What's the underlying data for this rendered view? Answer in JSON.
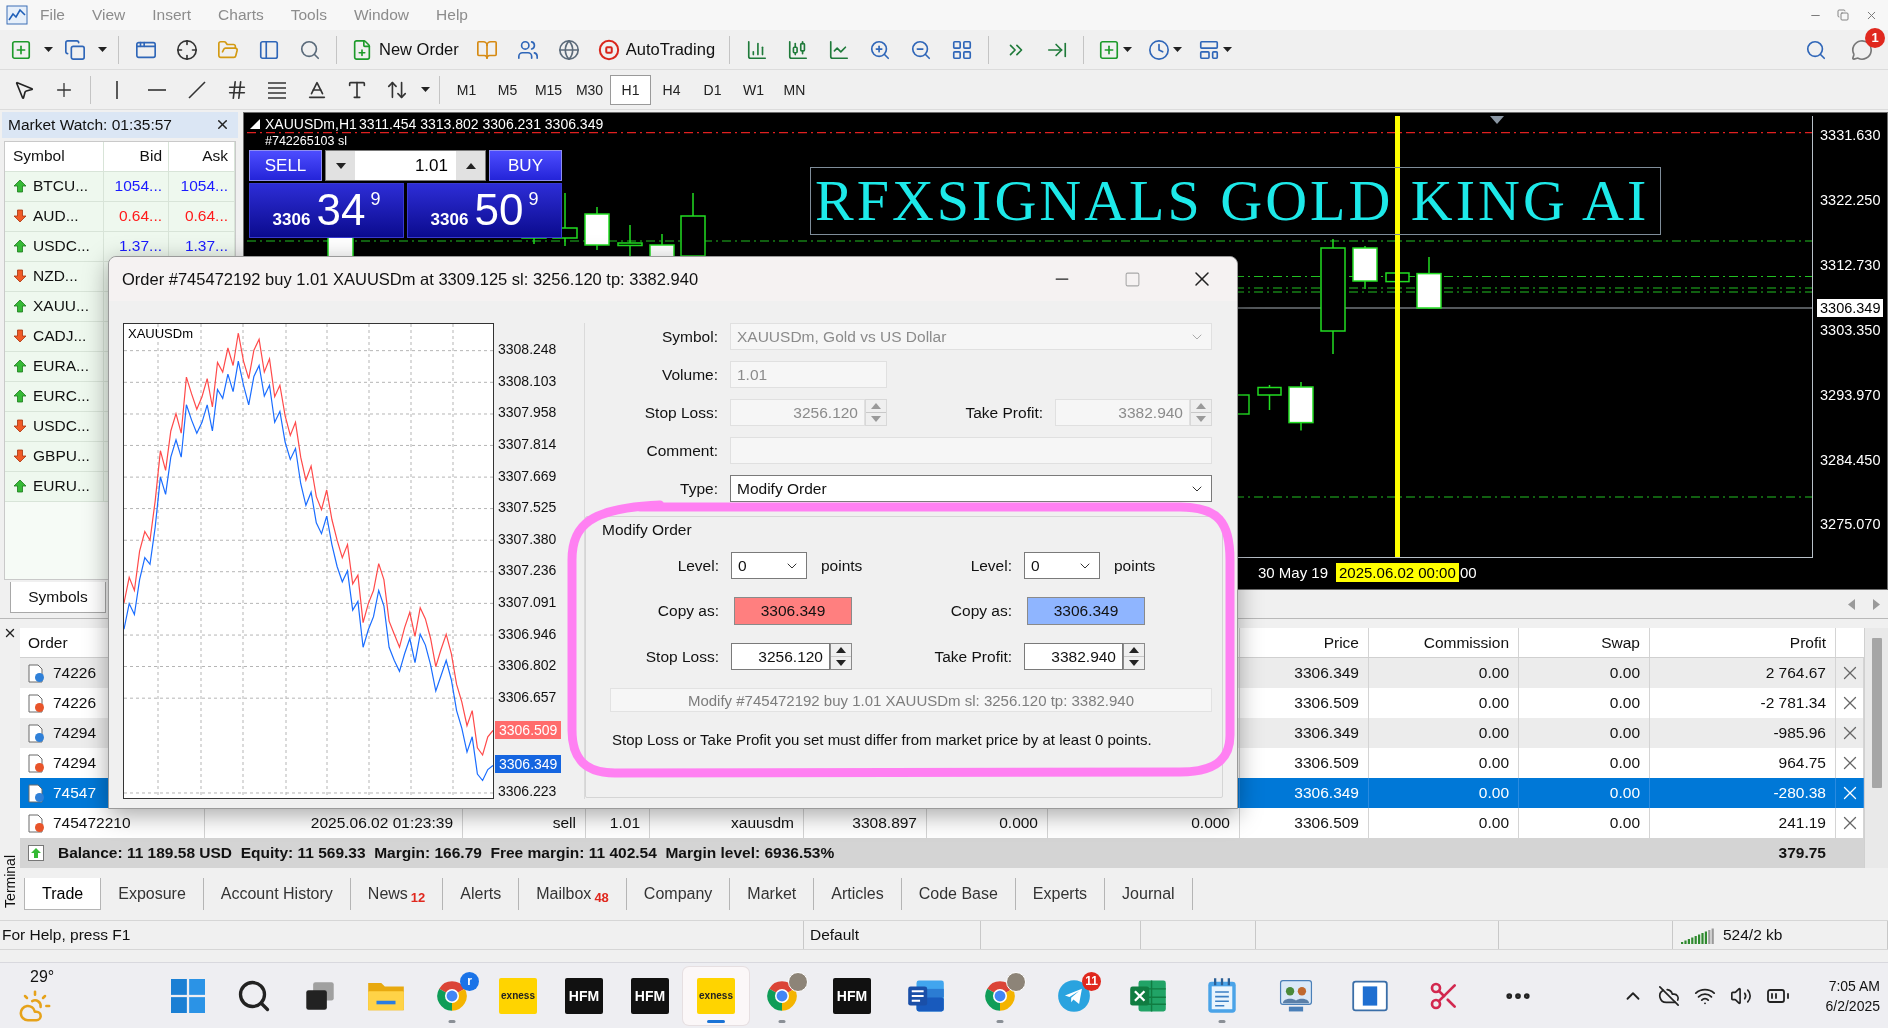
{
  "menu_bar": {
    "items": [
      "File",
      "View",
      "Insert",
      "Charts",
      "Tools",
      "Window",
      "Help"
    ]
  },
  "toolbar": {
    "new_order": "New Order",
    "auto_trading": "AutoTrading",
    "notification_badge": "1"
  },
  "timeframes": [
    {
      "label": "M1",
      "selected": false
    },
    {
      "label": "M5",
      "selected": false
    },
    {
      "label": "M15",
      "selected": false
    },
    {
      "label": "M30",
      "selected": false
    },
    {
      "label": "H1",
      "selected": true
    },
    {
      "label": "H4",
      "selected": false
    },
    {
      "label": "D1",
      "selected": false
    },
    {
      "label": "W1",
      "selected": false
    },
    {
      "label": "MN",
      "selected": false
    }
  ],
  "market_watch": {
    "title": "Market Watch: 01:35:57",
    "columns": [
      "Symbol",
      "Bid",
      "Ask"
    ],
    "rows": [
      {
        "symbol": "BTCU...",
        "bid": "1054...",
        "ask": "1054...",
        "kind": "up"
      },
      {
        "symbol": "AUD...",
        "bid": "0.64...",
        "ask": "0.64...",
        "kind": "down"
      },
      {
        "symbol": "USDC...",
        "bid": "1.37...",
        "ask": "1.37...",
        "kind": "up"
      },
      {
        "symbol": "NZD...",
        "kind": "down"
      },
      {
        "symbol": "XAUU...",
        "kind": "up"
      },
      {
        "symbol": "CADJ...",
        "kind": "down"
      },
      {
        "symbol": "EURA...",
        "kind": "up"
      },
      {
        "symbol": "EURC...",
        "kind": "up"
      },
      {
        "symbol": "USDC...",
        "kind": "down"
      },
      {
        "symbol": "GBPU...",
        "kind": "down"
      },
      {
        "symbol": "EURU...",
        "kind": "up"
      }
    ],
    "tab": "Symbols"
  },
  "chart": {
    "symbol_period": "XAUUSDm,H1",
    "ohlc": "3311.454 3313.802 3306.231 3306.349",
    "order_line_label": "#742265103 sl",
    "banner": "RFXSIGNALS GOLD KING AI",
    "price_scale": [
      "3331.630",
      "3322.250",
      "3312.730",
      "3303.350",
      "3293.970",
      "3284.450",
      "3275.070"
    ],
    "current_price": "3306.349",
    "time_scale": [
      {
        "kind": "label",
        "text": "30 May 19"
      },
      {
        "kind": "marker",
        "text": "2025.06.02 00:00"
      },
      {
        "kind": "label",
        "text": "00"
      }
    ]
  },
  "one_click": {
    "sell": "SELL",
    "buy": "BUY",
    "volume": "1.01",
    "sell_price": {
      "figure": "3306",
      "pips": "34",
      "point": "9"
    },
    "buy_price": {
      "figure": "3306",
      "pips": "50",
      "point": "9"
    }
  },
  "order_dialog": {
    "title": "Order #745472192 buy 1.01 XAUUSDm at 3309.125 sl: 3256.120 tp: 3382.940",
    "tick_chart": {
      "chart_data": {
        "type": "line",
        "title": "XAUUSDm",
        "grid": true,
        "ylim": [
          3306.2,
          3308.37
        ],
        "yticks": [
          3308.248,
          3308.103,
          3307.958,
          3307.814,
          3307.669,
          3307.525,
          {
            "value": 3307.38,
            "label": "3307.380"
          },
          3307.236,
          3307.091,
          3306.946,
          3306.802,
          3306.657,
          3306.223
        ],
        "series": [
          {
            "color": "#ff4a4a",
            "values": [
              3307.093,
              3307.21,
              3307.15,
              3307.33,
              3307.42,
              3307.38,
              3307.56,
              3307.79,
              3307.7,
              3307.88,
              3307.96,
              3307.87,
              3308.127,
              3308.05,
              3307.98,
              3308.037,
              3308.12,
              3307.99,
              3308.194,
              3308.15,
              3308.26,
              3308.18,
              3308.329,
              3308.2,
              3308.12,
              3308.25,
              3308.3,
              3308.15,
              3308.21,
              3308.037,
              3308.09,
              3307.95,
              3307.86,
              3307.92,
              3307.76,
              3307.655,
              3307.72,
              3307.58,
              3307.52,
              3307.61,
              3307.475,
              3307.38,
              3307.3,
              3307.36,
              3307.18,
              3307.22,
              3307.003,
              3307.09,
              3307.15,
              3307.273,
              3307.2,
              3307.01,
              3306.95,
              3306.891,
              3306.98,
              3307.05,
              3306.94,
              3307.071,
              3307.02,
              3306.93,
              3306.801,
              3306.88,
              3306.95,
              3306.86,
              3306.72,
              3306.64,
              3306.531,
              3306.6,
              3306.43,
              3306.397,
              3306.48,
              3306.509
            ]
          },
          {
            "color": "#1a6dff",
            "values": [
              3306.973,
              3307.09,
              3307.04,
              3307.2,
              3307.3,
              3307.27,
              3307.44,
              3307.67,
              3307.59,
              3307.76,
              3307.84,
              3307.76,
              3308,
              3307.93,
              3307.87,
              3307.92,
              3308,
              3307.88,
              3308.07,
              3308.03,
              3308.14,
              3308.06,
              3308.2,
              3308.09,
              3308,
              3308.13,
              3308.18,
              3308.04,
              3308.09,
              3307.92,
              3307.97,
              3307.83,
              3307.75,
              3307.8,
              3307.64,
              3307.54,
              3307.6,
              3307.46,
              3307.41,
              3307.49,
              3307.36,
              3307.26,
              3307.19,
              3307.24,
              3307.06,
              3307.1,
              3306.89,
              3306.97,
              3307.03,
              3307.15,
              3307.08,
              3306.89,
              3306.83,
              3306.78,
              3306.86,
              3306.93,
              3306.82,
              3306.95,
              3306.9,
              3306.81,
              3306.69,
              3306.76,
              3306.83,
              3306.74,
              3306.6,
              3306.52,
              3306.41,
              3306.48,
              3306.31,
              3306.28,
              3306.33,
              3306.349
            ]
          }
        ]
      },
      "ask": "3306.509",
      "bid": "3306.349"
    },
    "symbol": {
      "label": "Symbol:",
      "value": "XAUUSDm, Gold vs US Dollar",
      "disabled": true
    },
    "volume": {
      "label": "Volume:",
      "value": "1.01",
      "disabled": true
    },
    "stop_loss": {
      "label": "Stop Loss:",
      "value": "3256.120",
      "disabled": true
    },
    "take_profit": {
      "label": "Take Profit:",
      "value": "3382.940",
      "disabled": true
    },
    "comment": {
      "label": "Comment:",
      "disabled": true
    },
    "type": {
      "label": "Type:",
      "value": "Modify Order",
      "disabled": false
    },
    "modify": {
      "title": "Modify Order",
      "sides": [
        {
          "level_label": "Level:",
          "level": "0",
          "unit": "points",
          "copy_label": "Copy as:",
          "copy_value": "3306.349",
          "color": "#ff7f7f",
          "price_label": "Stop Loss:",
          "price": "3256.120"
        },
        {
          "level_label": "Level:",
          "level": "0",
          "unit": "points",
          "copy_label": "Copy as:",
          "copy_value": "3306.349",
          "color": "#8fb5ff",
          "price_label": "Take Profit:",
          "price": "3382.940"
        }
      ],
      "action": {
        "label": "Modify #745472192 buy 1.01 XAUUSDm sl: 3256.120 tp: 3382.940",
        "disabled": true
      },
      "note": "Stop Loss or Take Profit you set must differ from market price by at least 0 points."
    }
  },
  "terminal": {
    "label": "Terminal",
    "headers": {
      "order": "Order",
      "price": "Price",
      "commission": "Commission",
      "swap": "Swap",
      "profit": "Profit"
    },
    "rows": [
      {
        "order": "74226",
        "price": "3306.349",
        "commission": "0.00",
        "swap": "0.00",
        "profit": "2 764.67",
        "color": "#2f80d8",
        "selected": false
      },
      {
        "order": "74226",
        "price": "3306.509",
        "commission": "0.00",
        "swap": "0.00",
        "profit": "-2 781.34",
        "color": "#e8542a",
        "selected": false
      },
      {
        "order": "74294",
        "price": "3306.349",
        "commission": "0.00",
        "swap": "0.00",
        "profit": "-985.96",
        "color": "#2f80d8",
        "selected": false
      },
      {
        "order": "74294",
        "price": "3306.509",
        "commission": "0.00",
        "swap": "0.00",
        "profit": "964.75",
        "color": "#e8542a",
        "selected": false
      },
      {
        "order": "74547",
        "price": "3306.349",
        "commission": "0.00",
        "swap": "0.00",
        "profit": "-280.38",
        "color": "#2f80d8",
        "selected": true
      },
      {
        "order": "745472210",
        "column_2": "2025.06.02 01:23:39",
        "column_3": "sell",
        "column_4": "1.01",
        "column_5": "xauusdm",
        "column_6": "3308.897",
        "column_7": "0.000",
        "column_8": "0.000",
        "price": "3306.509",
        "commission": "0.00",
        "swap": "0.00",
        "profit": "241.19",
        "color": "#e8542a",
        "selected": false
      }
    ],
    "summary": {
      "text": "Balance: 11 189.58 USD  Equity: 11 569.33  Margin: 166.79  Free margin: 11 402.54  Margin level: 6936.53%",
      "profit": "379.75"
    },
    "tabs": [
      {
        "label": "Trade",
        "selected": true
      },
      {
        "label": "Exposure",
        "selected": false
      },
      {
        "label": "Account History",
        "selected": false
      },
      {
        "label": "News",
        "badge": "12",
        "selected": false
      },
      {
        "label": "Alerts",
        "selected": false
      },
      {
        "label": "Mailbox",
        "badge": "48",
        "selected": false
      },
      {
        "label": "Company",
        "selected": false
      },
      {
        "label": "Market",
        "selected": false
      },
      {
        "label": "Articles",
        "selected": false
      },
      {
        "label": "Code Base",
        "selected": false
      },
      {
        "label": "Experts",
        "selected": false
      },
      {
        "label": "Journal",
        "selected": false
      }
    ]
  },
  "status_bar": {
    "help": "For Help, press F1",
    "profile": "Default",
    "traffic": "524/2 kb"
  },
  "taskbar": {
    "weather": "29°",
    "apps": [
      {
        "kind": "start",
        "running": false,
        "selected": false
      },
      {
        "kind": "search",
        "running": false,
        "selected": false
      },
      {
        "kind": "task_view",
        "running": false,
        "selected": false
      },
      {
        "kind": "explorer",
        "running": false,
        "selected": false
      },
      {
        "kind": "browser",
        "badge": "r",
        "running": true,
        "selected": false
      },
      {
        "kind": "exness",
        "label": "exness",
        "running": false,
        "selected": false
      },
      {
        "kind": "hfm",
        "label": "HFM",
        "running": false,
        "selected": false
      },
      {
        "kind": "hfm",
        "label": "HFM",
        "running": false,
        "selected": false
      },
      {
        "kind": "exness",
        "label": "exness",
        "running": true,
        "selected": true
      },
      {
        "kind": "browser_profile",
        "running": true,
        "selected": false
      },
      {
        "kind": "hfm",
        "label": "HFM",
        "running": false,
        "selected": false
      },
      {
        "kind": "word",
        "running": false,
        "selected": false
      },
      {
        "kind": "browser_profile",
        "running": true,
        "selected": false
      },
      {
        "kind": "telegram",
        "badge": "11",
        "running": false,
        "selected": false
      },
      {
        "kind": "excel",
        "running": false,
        "selected": false
      },
      {
        "kind": "notepad",
        "running": true,
        "selected": false
      },
      {
        "kind": "remote",
        "running": false,
        "selected": false
      },
      {
        "kind": "window",
        "running": false,
        "selected": false
      },
      {
        "kind": "snipping",
        "running": false,
        "selected": false
      },
      {
        "kind": "more",
        "running": false,
        "selected": false
      }
    ],
    "time": "7:05 AM",
    "date": "6/2/2025"
  }
}
